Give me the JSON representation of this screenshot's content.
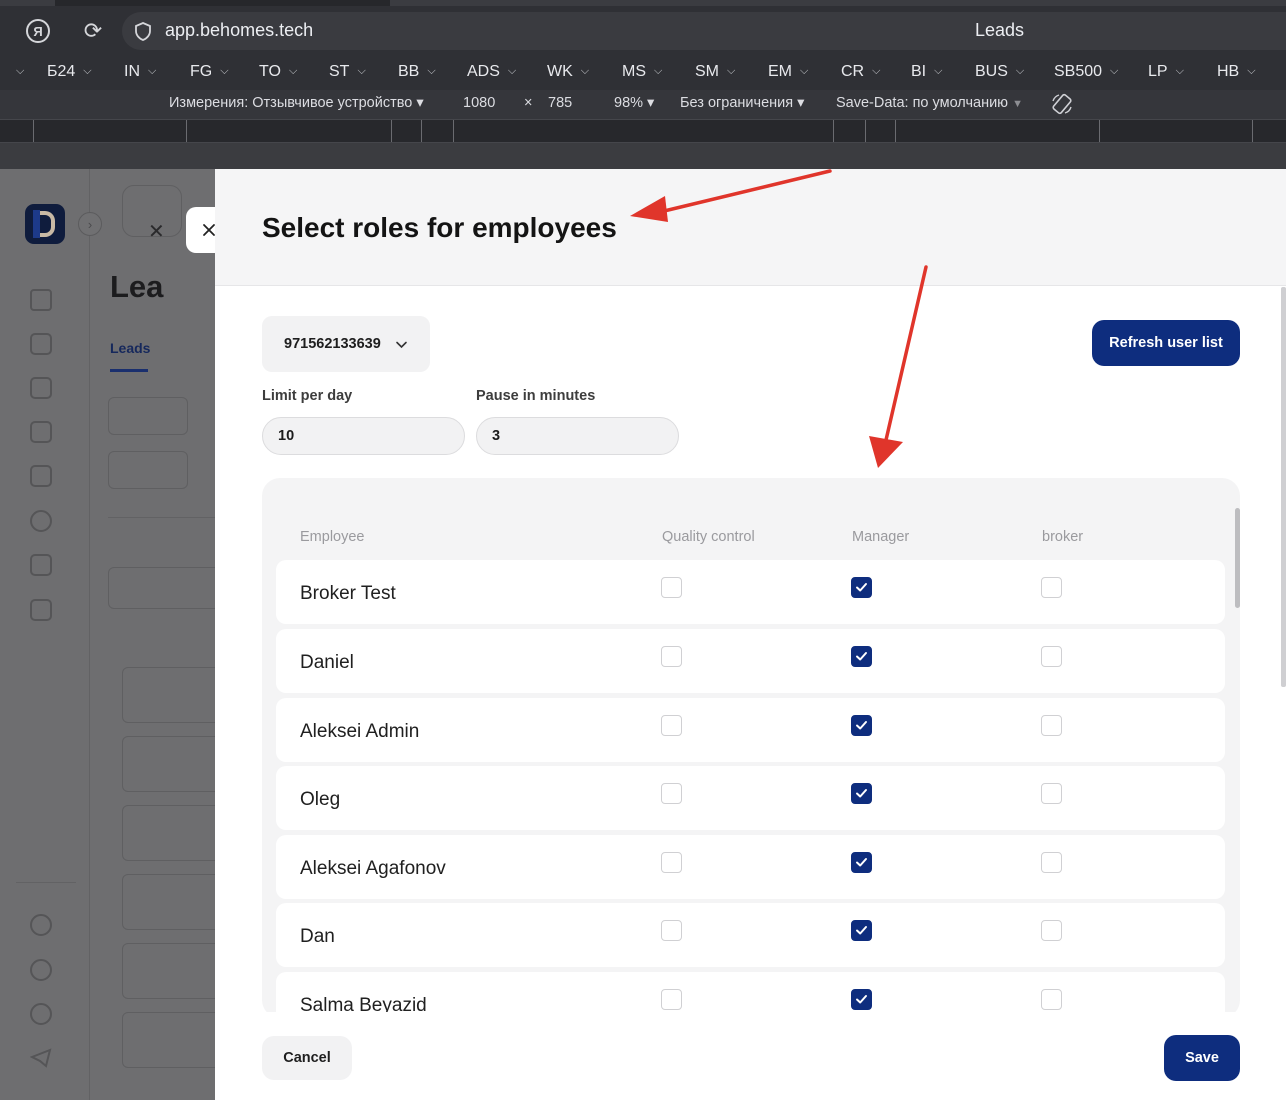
{
  "browser": {
    "url": "app.behomes.tech",
    "page_title": "Leads",
    "bookmarks": [
      "Б24",
      "IN",
      "FG",
      "TO",
      "ST",
      "BB",
      "ADS",
      "WK",
      "MS",
      "SM",
      "EM",
      "CR",
      "BI",
      "BUS",
      "SB500",
      "LP",
      "HB"
    ],
    "devtools": {
      "dimensions_label": "Измерения: Отзывчивое устройство ▾",
      "width": "1080",
      "times": "×",
      "height": "785",
      "zoom": "98% ▾",
      "throttle": "Без ограничения ▾",
      "save_data": "Save-Data: по умолчанию"
    }
  },
  "background_app": {
    "heading": "Lea",
    "tab": "Leads"
  },
  "modal": {
    "title": "Select roles for employees",
    "phone_select": "971562133639",
    "refresh_label": "Refresh user list",
    "limit_label": "Limit per day",
    "limit_value": "10",
    "pause_label": "Pause in minutes",
    "pause_value": "3",
    "columns": [
      "Employee",
      "Quality control",
      "Manager",
      "broker"
    ],
    "employees": [
      {
        "name": "Broker Test",
        "quality_control": false,
        "manager": true,
        "broker": false
      },
      {
        "name": "Daniel",
        "quality_control": false,
        "manager": true,
        "broker": false
      },
      {
        "name": "Aleksei Admin",
        "quality_control": false,
        "manager": true,
        "broker": false
      },
      {
        "name": "Oleg",
        "quality_control": false,
        "manager": true,
        "broker": false
      },
      {
        "name": "Aleksei Agafonov",
        "quality_control": false,
        "manager": true,
        "broker": false
      },
      {
        "name": "Dan",
        "quality_control": false,
        "manager": true,
        "broker": false
      },
      {
        "name": "Salma Beyazid",
        "quality_control": false,
        "manager": true,
        "broker": false
      }
    ],
    "cancel_label": "Cancel",
    "save_label": "Save"
  },
  "colors": {
    "primary": "#0e2d7e",
    "annotation_arrow": "#e0352b"
  }
}
